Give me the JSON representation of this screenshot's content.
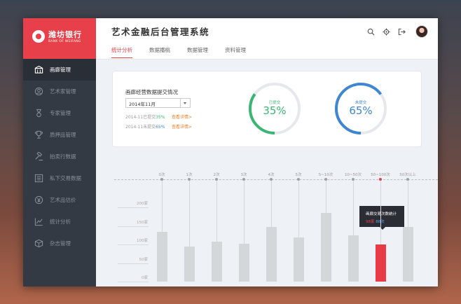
{
  "brand": {
    "name": "潍坊银行",
    "name_en": "BANK OF WEIFANG"
  },
  "sidebar": {
    "items": [
      {
        "label": "画廊管理",
        "icon": "gallery-icon",
        "active": true
      },
      {
        "label": "艺术家管理",
        "icon": "artist-icon",
        "active": false
      },
      {
        "label": "专家管理",
        "icon": "expert-icon",
        "active": false
      },
      {
        "label": "质押品管理",
        "icon": "trophy-icon",
        "active": false
      },
      {
        "label": "拍卖行数据",
        "icon": "gavel-icon",
        "active": false
      },
      {
        "label": "私下交易数据",
        "icon": "list-icon",
        "active": false
      },
      {
        "label": "艺术品估价",
        "icon": "yen-icon",
        "active": false
      },
      {
        "label": "统计分析",
        "icon": "line-chart-icon",
        "active": false
      },
      {
        "label": "杂志管理",
        "icon": "box-icon",
        "active": false
      }
    ]
  },
  "header": {
    "title": "艺术金融后台管理系统",
    "tabs": [
      {
        "label": "统计分析",
        "active": true
      },
      {
        "label": "数据播桃",
        "active": false
      },
      {
        "label": "数据管理",
        "active": false
      },
      {
        "label": "资料管理",
        "active": false
      }
    ],
    "icons": [
      "search-icon",
      "gear-icon",
      "logout-icon"
    ]
  },
  "summary": {
    "title": "画廊经营数据提交情况",
    "month": "2014年11月",
    "submitted": {
      "text": "2014-11已提交",
      "pct": "35%",
      "link": "查看详情>"
    },
    "unsubmitted": {
      "text": "2014-11未提交",
      "pct": "65%",
      "link": "查看详情>"
    },
    "ring_submitted": {
      "label": "已提交",
      "value": "35%",
      "fraction": 0.35,
      "color": "#3bb573"
    },
    "ring_unsubmitted": {
      "label": "未提交",
      "value": "65%",
      "fraction": 0.65,
      "color": "#3e86d1"
    }
  },
  "chart_data": {
    "type": "bar",
    "categories": [
      "0次",
      "1次",
      "2次",
      "3次",
      "4次",
      "5次",
      "5~10次",
      "10~50次",
      "50~100次",
      "50次以上"
    ],
    "values": [
      130,
      92,
      104,
      100,
      144,
      116,
      179,
      121,
      98,
      144
    ],
    "highlight_index": 8,
    "y_ticks": [
      "200家",
      "150家",
      "100家",
      "50家",
      "0家"
    ],
    "ylim": [
      0,
      200
    ],
    "tooltip": {
      "title": "画廊交易次数统计",
      "count": "98家",
      "times": "88次"
    },
    "colors": {
      "bar": "#d4d7da",
      "highlight": "#e83b47"
    }
  }
}
